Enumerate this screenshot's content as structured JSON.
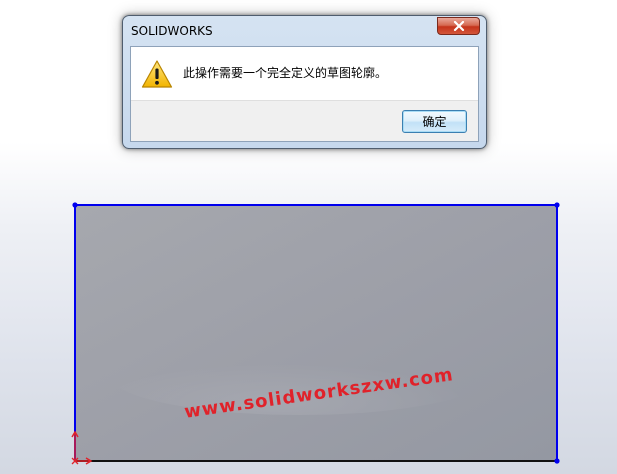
{
  "dialog": {
    "title": "SOLIDWORKS",
    "message": "此操作需要一个完全定义的草图轮廓。",
    "ok_label": "确定",
    "icons": {
      "warning": "warning-icon",
      "close": "close-icon"
    }
  },
  "canvas": {
    "sketch_shape": "rectangle",
    "line_color": "#0000ee",
    "fill_color": "#9a9ea8",
    "origin_color": "#e0222a"
  },
  "watermark": {
    "text": "www.solidworkszxw.com",
    "color": "#e0222a"
  }
}
